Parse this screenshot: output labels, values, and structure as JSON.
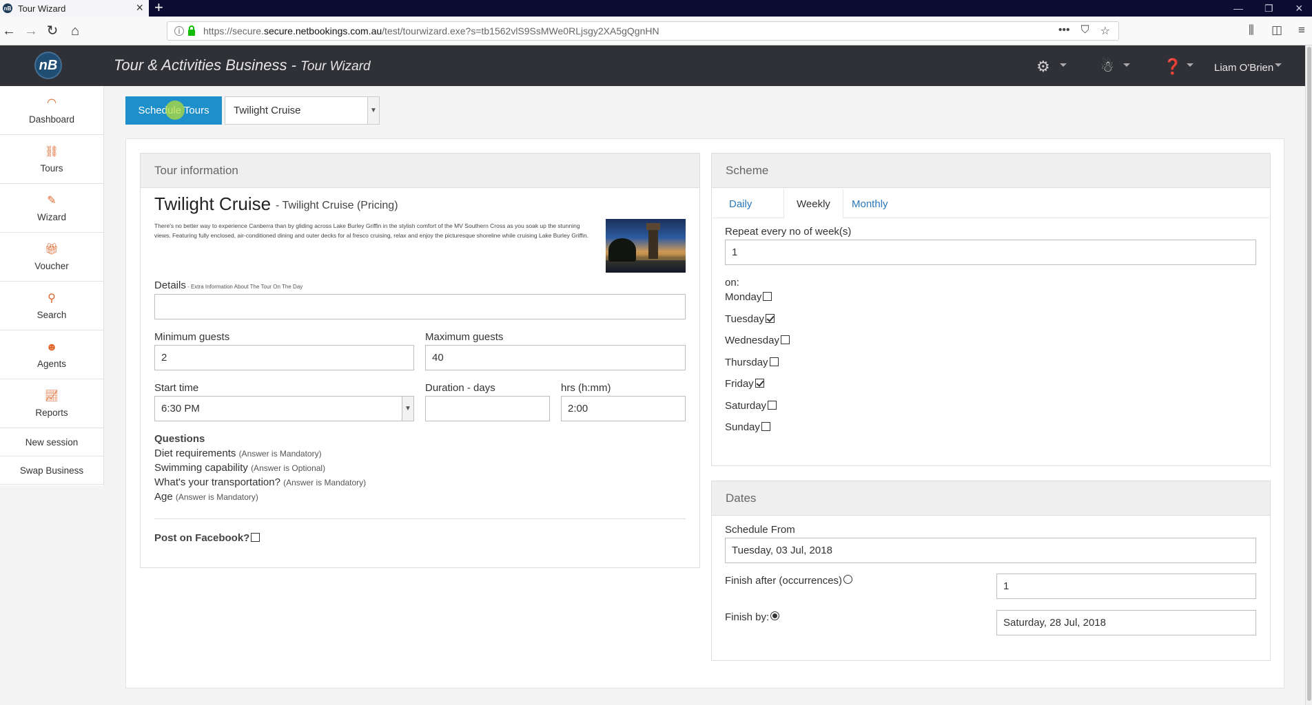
{
  "browser": {
    "tab_title": "Tour Wizard",
    "favicon_text": "nB",
    "url_domain": "secure.netbookings.com.au",
    "url_prefix": "https://secure.",
    "url_suffix": "/test/tourwizard.exe?s=tb1562vlS9SsMWe0RLjsgy2XA5gQgnHN"
  },
  "header": {
    "logo_text": "nB",
    "title_main": "Tour & Activities Business",
    "title_sep": " - ",
    "title_sub": "Tour Wizard",
    "user_name": "Liam O'Brien"
  },
  "sidebar": {
    "items": [
      {
        "label": "Dashboard",
        "icon": "dashboard-icon"
      },
      {
        "label": "Tours",
        "icon": "tours-icon"
      },
      {
        "label": "Wizard",
        "icon": "wizard-icon"
      },
      {
        "label": "Voucher",
        "icon": "gift-icon"
      },
      {
        "label": "Search",
        "icon": "search-icon"
      },
      {
        "label": "Agents",
        "icon": "agent-icon"
      },
      {
        "label": "Reports",
        "icon": "reports-icon"
      }
    ],
    "links": [
      "New session",
      "Swap Business"
    ]
  },
  "toolbar": {
    "schedule_label": "Schedule Tours",
    "tour_select_value": "Twilight Cruise"
  },
  "tour_info": {
    "heading": "Tour information",
    "name": "Twilight Cruise",
    "pricing": "- Twilight Cruise (Pricing)",
    "description": "There's no better way to experience Canberra than by gliding across Lake Burley Griffin in the stylish comfort of the MV Southern Cross as you soak up the stunning views. Featuring fully enclosed, air-conditioned dining and outer decks for al fresco cruising, relax and enjoy the picturesque shoreline while cruising Lake Burley Griffin.",
    "details_label": "Details",
    "details_note": " - Extra Information About The Tour On The Day",
    "details_value": "",
    "min_guests_label": "Minimum guests",
    "min_guests_value": "2",
    "max_guests_label": "Maximum guests",
    "max_guests_value": "40",
    "start_time_label": "Start time",
    "start_time_value": "6:30 PM",
    "duration_days_label": "Duration - days",
    "duration_days_value": "",
    "hrs_label": "hrs (h:mm)",
    "hrs_value": "2:00",
    "questions_label": "Questions",
    "questions": [
      {
        "text": "Diet requirements",
        "note": "(Answer is Mandatory)"
      },
      {
        "text": "Swimming capability",
        "note": "(Answer is Optional)"
      },
      {
        "text": "What's your transportation?",
        "note": "(Answer is Mandatory)"
      },
      {
        "text": "Age",
        "note": "(Answer is Mandatory)"
      }
    ],
    "facebook_label": "Post on Facebook?",
    "facebook_checked": false
  },
  "scheme": {
    "heading": "Scheme",
    "tabs": [
      "Daily",
      "Weekly",
      "Monthly"
    ],
    "active_tab": "Weekly",
    "repeat_label": "Repeat every no of week(s)",
    "repeat_value": "1",
    "on_label": "on:",
    "days": [
      {
        "name": "Monday",
        "checked": false
      },
      {
        "name": "Tuesday",
        "checked": true
      },
      {
        "name": "Wednesday",
        "checked": false
      },
      {
        "name": "Thursday",
        "checked": false
      },
      {
        "name": "Friday",
        "checked": true
      },
      {
        "name": "Saturday",
        "checked": false
      },
      {
        "name": "Sunday",
        "checked": false
      }
    ]
  },
  "dates": {
    "heading": "Dates",
    "schedule_from_label": "Schedule From",
    "schedule_from_value": "Tuesday, 03 Jul, 2018",
    "finish_after_label": "Finish after (occurrences)",
    "finish_after_value": "1",
    "finish_by_label": "Finish by:",
    "finish_by_value": "Saturday, 28 Jul, 2018",
    "finish_mode": "by"
  }
}
